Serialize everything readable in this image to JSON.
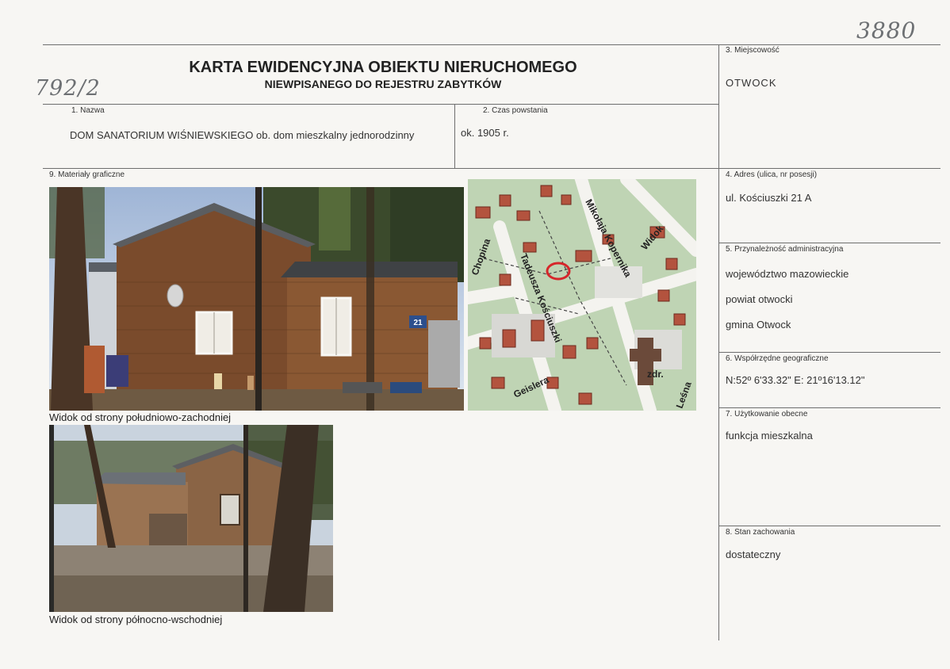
{
  "header": {
    "title": "KARTA EWIDENCYJNA OBIEKTU NIERUCHOMEGO",
    "subtitle": "NIEWPISANEGO DO REJESTRU ZABYTKÓW"
  },
  "handwritten": {
    "inventory_number": "3880",
    "catalog_number": "792/2"
  },
  "fields": {
    "nazwa": {
      "label": "1.   Nazwa",
      "value": "DOM SANATORIUM WIŚNIEWSKIEGO ob. dom mieszkalny jednorodzinny"
    },
    "czas": {
      "label": "2.   Czas powstania",
      "value": "ok. 1905 r."
    },
    "miejscowosc": {
      "label": "3. Miejscowość",
      "value": "OTWOCK"
    },
    "adres": {
      "label": "4. Adres (ulica, nr posesji)",
      "value": "ul. Kościuszki 21 A"
    },
    "przynaleznosc": {
      "label": "5. Przynależność administracyjna",
      "values": [
        "województwo mazowieckie",
        "powiat otwocki",
        "gmina Otwock"
      ]
    },
    "wspolrzedne": {
      "label": "6. Współrzędne geograficzne",
      "value": "N:52º 6'33.32\" E: 21º16'13.12\""
    },
    "uzytkowanie": {
      "label": "7. Użytkowanie obecne",
      "value": "funkcja mieszkalna"
    },
    "stan": {
      "label": "8. Stan zachowania",
      "value": "dostateczny"
    },
    "materialy": {
      "label": "9. Materiały graficzne"
    }
  },
  "photos": {
    "photo1_caption": "Widok od strony południowo-zachodniej",
    "photo2_caption": "Widok od strony północno-wschodniej",
    "house_number": "21"
  },
  "map": {
    "streets": [
      "Mikołaja Kopernika",
      "Tadeusza Kościuszki",
      "Widok",
      "Chopina",
      "Geislera",
      "Leśna"
    ],
    "labels": [
      "zdr."
    ]
  }
}
